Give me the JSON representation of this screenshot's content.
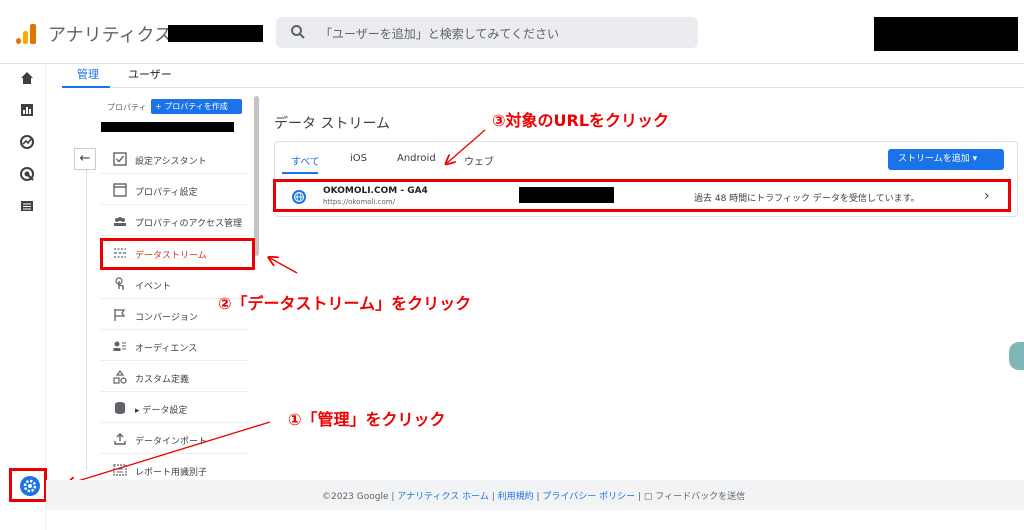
{
  "header": {
    "app_title": "アナリティクス",
    "search_placeholder": "「ユーザーを追加」と検索してみてください"
  },
  "admin_tabs": [
    {
      "label": "管理",
      "active": true
    },
    {
      "label": "ユーザー",
      "active": false
    }
  ],
  "property": {
    "label": "プロパティ",
    "create_button": "+ プロパティを作成"
  },
  "menu": [
    {
      "label": "設定アシスタント",
      "icon": "checkbox-icon"
    },
    {
      "label": "プロパティ設定",
      "icon": "window-icon"
    },
    {
      "label": "プロパティのアクセス管理",
      "icon": "people-icon"
    },
    {
      "label": "データストリーム",
      "icon": "streams-icon",
      "active": true
    },
    {
      "label": "イベント",
      "icon": "touch-icon"
    },
    {
      "label": "コンバージョン",
      "icon": "flag-icon"
    },
    {
      "label": "オーディエンス",
      "icon": "audience-icon"
    },
    {
      "label": "カスタム定義",
      "icon": "shapes-icon"
    },
    {
      "label": "データ設定",
      "icon": "database-icon"
    },
    {
      "label": "データインポート",
      "icon": "upload-icon"
    },
    {
      "label": "レポート用識別子",
      "icon": "identifier-icon"
    }
  ],
  "main": {
    "title": "データ ストリーム",
    "filter_tabs": [
      {
        "label": "すべて",
        "active": true
      },
      {
        "label": "iOS"
      },
      {
        "label": "Android"
      },
      {
        "label": "ウェブ"
      }
    ],
    "add_stream_button": "ストリームを追加 ▾",
    "stream": {
      "name": "OKOMOLI.COM - GA4",
      "url": "https://okomoli.com/",
      "status": "過去 48 時間にトラフィック データを受信しています。"
    }
  },
  "annotations": {
    "step1": "①「管理」をクリック",
    "step2": "②「データストリーム」をクリック",
    "step3": "③対象のURLをクリック"
  },
  "footer": {
    "copyright": "©2023 Google | ",
    "link_home": "アナリティクス ホーム",
    "sep1": " | ",
    "link_terms": "利用規約",
    "sep2": " | ",
    "link_privacy": "プライバシー ポリシー",
    "sep3": " | ",
    "feedback": "フィードバックを送信"
  },
  "colors": {
    "accent": "#1a73e8",
    "annotation": "#e00000",
    "active_menu": "#d93025"
  }
}
